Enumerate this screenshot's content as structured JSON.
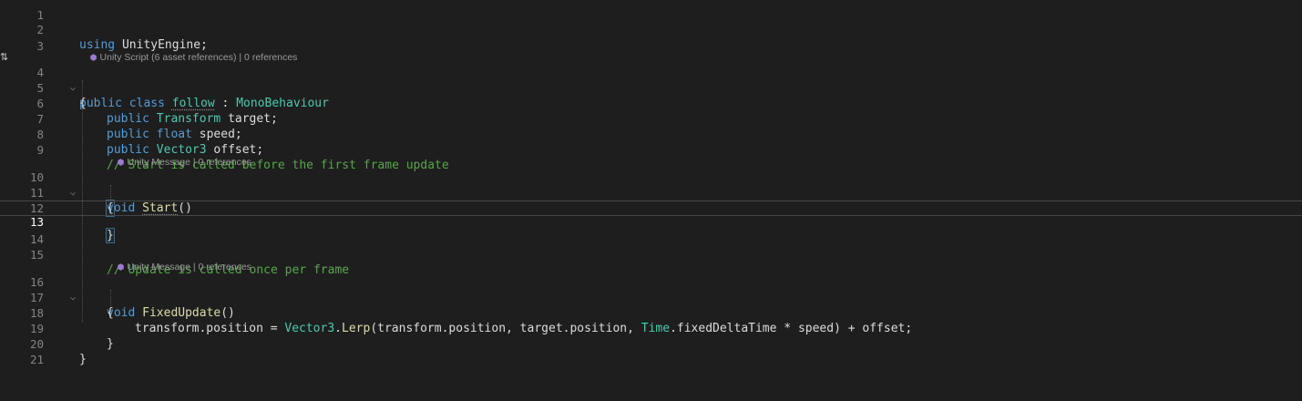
{
  "editor": {
    "current_line": 13,
    "codelens": {
      "class_lens": "Unity Script (6 asset references) | 0 references",
      "start_lens": "Unity Message | 0 references",
      "update_lens": "Unity Message | 0 references",
      "lens_icon": "unity-cube-icon"
    },
    "line_numbers": [
      "1",
      "2",
      "3",
      "4",
      "5",
      "6",
      "7",
      "8",
      "9",
      "10",
      "11",
      "12",
      "13",
      "14",
      "15",
      "16",
      "17",
      "18",
      "19",
      "20",
      "21"
    ],
    "margin_icon": "override-arrows-icon",
    "margin_glyph": "⇅",
    "fold_glyph": "⌵",
    "lines": {
      "l2": {
        "kw": "using",
        "rest": " UnityEngine;"
      },
      "l4": {
        "kw1": "public",
        "kw2": "class",
        "name": "follow",
        "sep": " : ",
        "base": "MonoBehaviour"
      },
      "l5": {
        "text": "{"
      },
      "l6": {
        "kw": "public",
        "type": "Transform",
        "rest": " target;"
      },
      "l7": {
        "kw": "public",
        "type": "float",
        "rest": " speed;"
      },
      "l8": {
        "kw": "public",
        "type": "Vector3",
        "rest": " offset;"
      },
      "l9": {
        "comment": "// Start is called before the first frame update"
      },
      "l10": {
        "kw": "void",
        "fn": "Start",
        "rest": "()"
      },
      "l11": {
        "text": "{"
      },
      "l13": {
        "text": "}"
      },
      "l15": {
        "comment": "// Update is called once per frame"
      },
      "l16": {
        "kw": "void",
        "fn": "FixedUpdate",
        "rest": "()"
      },
      "l17": {
        "text": "{"
      },
      "l18": {
        "a": "transform",
        "b": ".position = ",
        "c": "Vector3",
        "d": ".",
        "e": "Lerp",
        "f": "(transform",
        "g": ".position, target",
        "h": ".position, ",
        "i": "Time",
        "j": ".fixedDeltaTime * speed) + offset;"
      },
      "l19": {
        "text": "}"
      },
      "l20": {
        "text": "}"
      }
    }
  },
  "colors": {
    "background": "#1e1e1e",
    "keyword": "#569cd6",
    "type": "#4ec9b0",
    "method": "#dcdcaa",
    "comment": "#57a64a",
    "line_number": "#858585"
  }
}
